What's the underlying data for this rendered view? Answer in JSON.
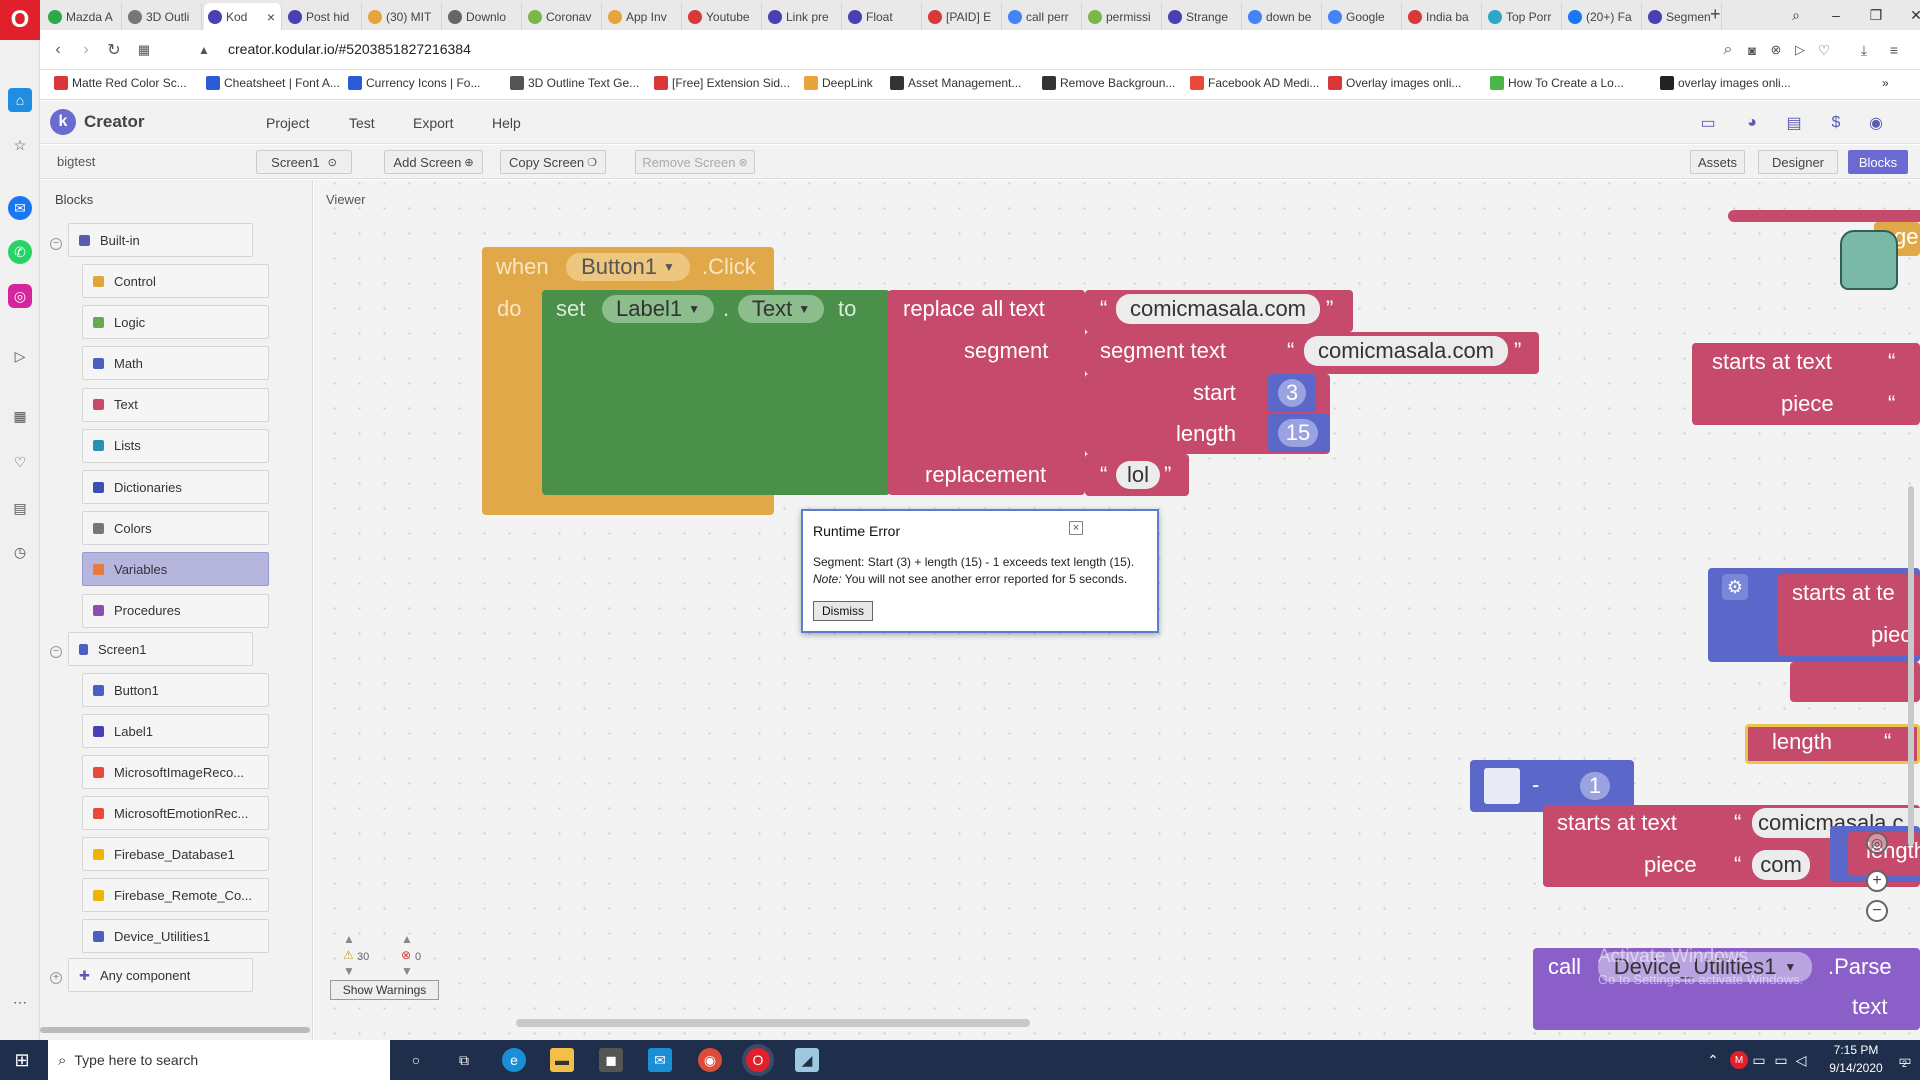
{
  "browser": {
    "tabs": [
      {
        "label": "Mazda A",
        "color": "#2aa84a"
      },
      {
        "label": "3D Outli",
        "color": "#777777"
      },
      {
        "label": "Kod",
        "color": "#4a3fb5"
      },
      {
        "label": "Post hid",
        "color": "#4a3fb5"
      },
      {
        "label": "(30) MIT",
        "color": "#e8a33a"
      },
      {
        "label": "Downlo",
        "color": "#666666"
      },
      {
        "label": "Coronav",
        "color": "#7ab648"
      },
      {
        "label": "App Inv",
        "color": "#e8a33a"
      },
      {
        "label": "Youtube",
        "color": "#d93838"
      },
      {
        "label": "Link pre",
        "color": "#4a3fb5"
      },
      {
        "label": "Float",
        "color": "#4a3fb5"
      },
      {
        "label": "[PAID] E",
        "color": "#d93838"
      },
      {
        "label": "call perr",
        "color": "#4285f4"
      },
      {
        "label": "permissi",
        "color": "#7ab648"
      },
      {
        "label": "Strange",
        "color": "#4a3fb5"
      },
      {
        "label": "down be",
        "color": "#4285f4"
      },
      {
        "label": "Google",
        "color": "#4285f4"
      },
      {
        "label": "India ba",
        "color": "#d93838"
      },
      {
        "label": "Top Porr",
        "color": "#2aa8c8"
      },
      {
        "label": "(20+) Fa",
        "color": "#1877f2"
      },
      {
        "label": "Segmen",
        "color": "#4a3fb5"
      }
    ],
    "url": "creator.kodular.io/#5203851827216384",
    "bookmarks": [
      {
        "label": "Matte Red Color Sc...",
        "color": "#d93838"
      },
      {
        "label": "Cheatsheet | Font A...",
        "color": "#2a5bd7"
      },
      {
        "label": "Currency Icons | Fo...",
        "color": "#2a5bd7"
      },
      {
        "label": "3D Outline Text Ge...",
        "color": "#555555"
      },
      {
        "label": "[Free] Extension Sid...",
        "color": "#d93838"
      },
      {
        "label": "DeepLink",
        "color": "#e8a33a"
      },
      {
        "label": "Asset Management...",
        "color": "#333333"
      },
      {
        "label": "Remove Backgroun...",
        "color": "#333333"
      },
      {
        "label": "Facebook AD Medi...",
        "color": "#e84a3a"
      },
      {
        "label": "Overlay images onli...",
        "color": "#d93838"
      },
      {
        "label": "How To Create a Lo...",
        "color": "#4ab648"
      },
      {
        "label": "overlay images onli...",
        "color": "#222222"
      }
    ]
  },
  "app": {
    "brand": "Creator",
    "menu": [
      "Project",
      "Test",
      "Export",
      "Help"
    ],
    "project_name": "bigtest",
    "screen_select": "Screen1",
    "add_screen": "Add Screen",
    "copy_screen": "Copy Screen",
    "remove_screen": "Remove Screen",
    "view_buttons": [
      "Assets",
      "Designer",
      "Blocks"
    ],
    "accent": "#6a6ad0"
  },
  "blocks_panel": {
    "title": "Blocks",
    "builtin_label": "Built-in",
    "builtin_items": [
      {
        "label": "Control",
        "color": "#e1a33a"
      },
      {
        "label": "Logic",
        "color": "#6aa84f"
      },
      {
        "label": "Math",
        "color": "#4a5fc1"
      },
      {
        "label": "Text",
        "color": "#c9476a"
      },
      {
        "label": "Lists",
        "color": "#2a8fb0"
      },
      {
        "label": "Dictionaries",
        "color": "#3d4fb5"
      },
      {
        "label": "Colors",
        "color": "#777777"
      },
      {
        "label": "Variables",
        "color": "#e87a3a"
      },
      {
        "label": "Procedures",
        "color": "#8a4fb5"
      }
    ],
    "screen_label": "Screen1",
    "screen_items": [
      {
        "label": "Button1",
        "color": "#4a5fc1"
      },
      {
        "label": "Label1",
        "color": "#4a3fb5"
      },
      {
        "label": "MicrosoftImageReco...",
        "color": "#e84a3a"
      },
      {
        "label": "MicrosoftEmotionRec...",
        "color": "#e84a3a"
      },
      {
        "label": "Firebase_Database1",
        "color": "#f0b400"
      },
      {
        "label": "Firebase_Remote_Co...",
        "color": "#f0b400"
      },
      {
        "label": "Device_Utilities1",
        "color": "#4a5fc1"
      }
    ],
    "any_component": "Any component"
  },
  "viewer": {
    "title": "Viewer",
    "event_when": "when",
    "event_component": "Button1",
    "event_name": ".Click",
    "event_do": "do",
    "set_kw": "set",
    "set_component": "Label1",
    "set_dot": ".",
    "set_property": "Text",
    "set_to": "to",
    "replace_all": "replace all text",
    "replace_text_value": "comicmasala.com",
    "segment_label": "segment",
    "segment_text_label": "segment  text",
    "segment_text_value": "comicmasala.com",
    "start_label": "start",
    "start_value": "3",
    "length_label": "length",
    "length_value": "15",
    "replacement_label": "replacement",
    "replacement_value": "lol",
    "quote_open": "“",
    "quote_close": "”",
    "starts_at_text": "starts at  text",
    "piece_label": "piece",
    "starts_at_text_2": "starts at  te",
    "piece_2": "piec",
    "length_2": "length",
    "minus": "-",
    "one": "1",
    "starts_at_text_3": "starts at  text",
    "piece_3": "piece",
    "comicmasala_partial": "comicmasala.c",
    "com_value": "com",
    "length_3": "length",
    "call_kw": "call",
    "call_component": "Device_Utilities1",
    "call_method": ".Parse",
    "call_text": "text",
    "ge_partial": "ge",
    "warnings_count": "30",
    "errors_count": "0",
    "show_warnings": "Show Warnings",
    "activate_title": "Activate Windows",
    "activate_sub": "Go to Settings to activate Windows."
  },
  "dialog": {
    "title": "Runtime Error",
    "message": "Segment: Start (3) + length (15) - 1 exceeds text length (15).",
    "note_label": "Note:",
    "note_text": " You will not see another error reported for 5 seconds.",
    "dismiss": "Dismiss"
  },
  "taskbar": {
    "search_placeholder": "Type here to search",
    "time": "7:15 PM",
    "date": "9/14/2020",
    "notif_count": "2"
  }
}
